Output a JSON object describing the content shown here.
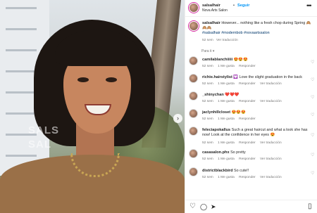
{
  "post": {
    "username": "salsalhair",
    "separator": "•",
    "follow_label": "Seguir",
    "location": "Nova Arts Salon",
    "more_label": "•••"
  },
  "media": {
    "watermark_line1": "SALS",
    "watermark_line2": "SAL",
    "next_label": "›"
  },
  "caption": {
    "username": "salsalhair",
    "text": "However... nothing like a fresh chop during Spring 🙈🙈🙈",
    "hashtags": "#salsalhair #modernbob #novaartssalon",
    "time": "52 sem",
    "translate_label": "Ver traducción"
  },
  "section_label": "Para ti ▾",
  "comments": [
    {
      "username": "camilablanchiiiii",
      "text": "😍😍😍",
      "time": "52 sem",
      "likes": "1 Me gusta",
      "reply": "Responder",
      "translate": ""
    },
    {
      "username": "richie.hairstylist",
      "text": "💟 Love the slight graduation in the back",
      "time": "52 sem",
      "likes": "1 Me gusta",
      "reply": "Responder",
      "translate": "Ver traducción"
    },
    {
      "username": "_shinychan",
      "text": "❤️❤️❤️",
      "time": "52 sem",
      "likes": "1 Me gusta",
      "reply": "Responder",
      "translate": "Ver traducción"
    },
    {
      "username": "jaclynhillcloset",
      "text": "😍😍😍",
      "time": "52 sem",
      "likes": "1 Me gusta",
      "reply": "Responder",
      "translate": ""
    },
    {
      "username": "feleciapokallus",
      "text": "Such a great haircut and what a look she has now! Look at the confidence in her eyes 😍",
      "time": "52 sem",
      "likes": "1 Me gusta",
      "reply": "Responder",
      "translate": "Ver traducción"
    },
    {
      "username": "casasalon.phx",
      "text": "So pretty",
      "time": "52 sem",
      "likes": "1 Me gusta",
      "reply": "Responder",
      "translate": "Ver traducción"
    },
    {
      "username": "districtblackbird",
      "text": "So cute!!",
      "time": "52 sem",
      "likes": "1 Me gusta",
      "reply": "Responder",
      "translate": "Ver traducción"
    }
  ],
  "actions": {
    "like": "♡",
    "comment": "◯",
    "share": "➤",
    "save": "▯"
  },
  "colors": {
    "link_blue": "#0095f6",
    "hashtag_blue": "#00376b",
    "meta_gray": "#737373",
    "text": "#262626"
  }
}
